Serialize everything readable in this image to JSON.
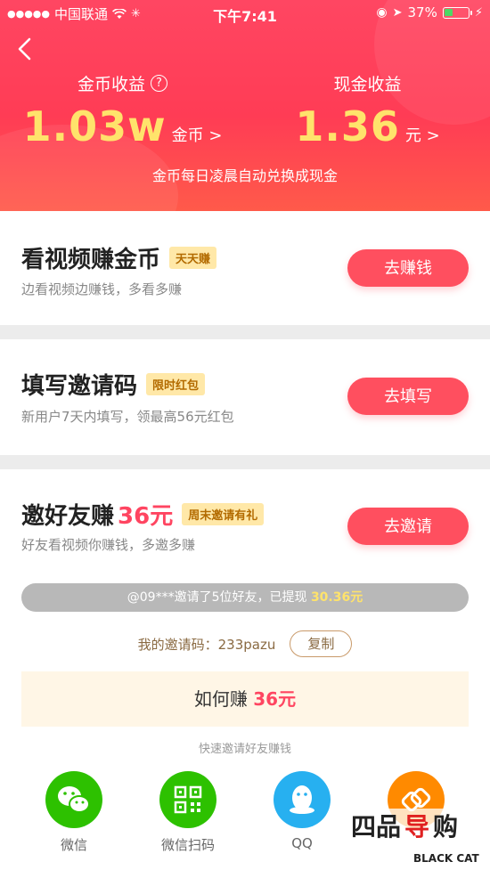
{
  "status": {
    "carrier": "中国联通",
    "time": "下午7:41",
    "battery": "37%",
    "battery_level": 0.37
  },
  "header": {
    "coins_label": "金币收益",
    "coins_value": "1.03w",
    "coins_unit": "金币 >",
    "cash_label": "现金收益",
    "cash_value": "1.36",
    "cash_unit": "元 >",
    "note": "金币每日凌晨自动兑换成现金"
  },
  "tasks": [
    {
      "title": "看视频赚金币",
      "tag": "天天赚",
      "desc": "边看视频边赚钱，多看多赚",
      "button": "去赚钱"
    },
    {
      "title": "填写邀请码",
      "tag": "限时红包",
      "desc": "新用户7天内填写，领最高56元红包",
      "button": "去填写"
    },
    {
      "title": "邀好友赚",
      "amount": "36元",
      "tag": "周末邀请有礼",
      "desc": "好友看视频你赚钱，多邀多赚",
      "button": "去邀请"
    }
  ],
  "invite": {
    "notice_text": "@09***邀请了5位好友，已提现",
    "notice_amount": "30.36元",
    "code_label": "我的邀请码：233pazu",
    "copy": "复制",
    "how_text": "如何赚",
    "how_amount": "36元",
    "quick": "快速邀请好友赚钱"
  },
  "share": [
    {
      "label": "微信",
      "icon": "wechat-icon",
      "color": "#2dc100"
    },
    {
      "label": "微信扫码",
      "icon": "qrcode-icon",
      "color": "#2dc100"
    },
    {
      "label": "QQ",
      "icon": "qq-icon",
      "color": "#27b0f0"
    },
    {
      "label": "",
      "icon": "link-icon",
      "color": "#ff8a00"
    }
  ],
  "watermark": {
    "text": "BLACK CAT"
  },
  "colors": {
    "header": "#ff4662",
    "accent": "#ff4f5f",
    "gold": "#ffe36b"
  }
}
